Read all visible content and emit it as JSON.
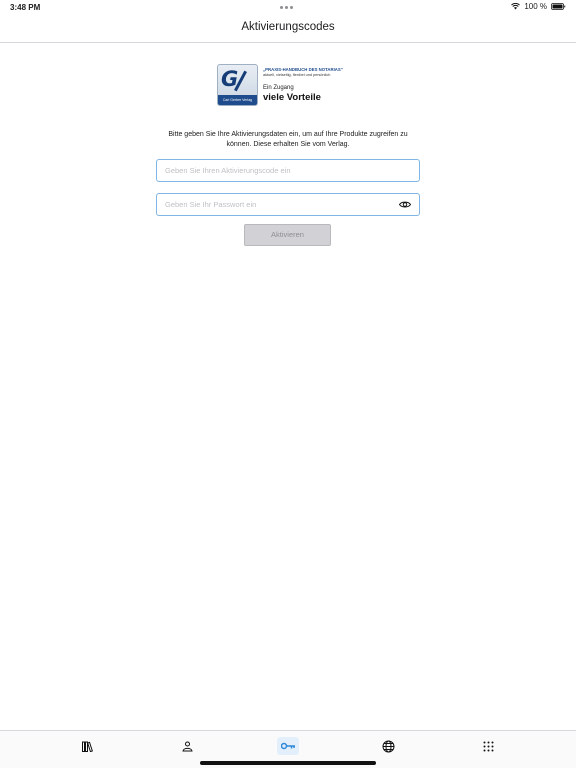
{
  "status_bar": {
    "time": "3:48 PM",
    "battery": "100 %",
    "icons": [
      "wifi-icon",
      "battery-icon"
    ]
  },
  "nav": {
    "title": "Aktivierungscodes"
  },
  "promo": {
    "logo_footer": "Carl Gerber Verlag",
    "headline": "„PRAXIS-HANDBUCH DES NOTARIAS“",
    "subline": "aktuell, vielseitig, flexibel und persönlich",
    "tagline_line1": "Ein Zugang",
    "tagline_line2": "viele Vorteile"
  },
  "form": {
    "instructions": "Bitte geben Sie Ihre Aktivierungsdaten ein, um auf Ihre Produkte zugreifen zu können. Diese erhalten Sie vom Verlag.",
    "code_placeholder": "Geben Sie Ihren Aktivierungscode ein",
    "code_value": "",
    "password_placeholder": "Geben Sie Ihr Passwort ein",
    "password_value": "",
    "submit_label": "Aktivieren"
  },
  "tab_bar": {
    "tabs": [
      {
        "icon": "library-icon",
        "active": false
      },
      {
        "icon": "person-icon",
        "active": false
      },
      {
        "icon": "key-icon",
        "active": true
      },
      {
        "icon": "globe-icon",
        "active": false
      },
      {
        "icon": "grid-icon",
        "active": false
      }
    ],
    "accent_color": "#2f87d8"
  }
}
